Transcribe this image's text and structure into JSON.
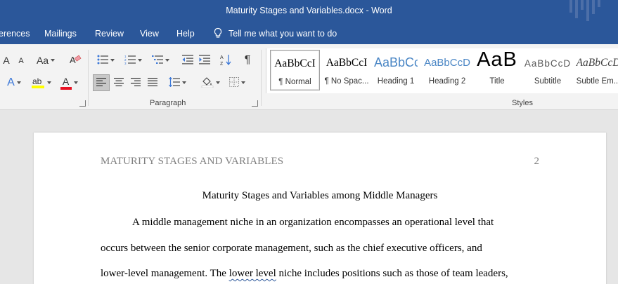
{
  "window": {
    "title": "Maturity Stages and Variables.docx  -  Word"
  },
  "tabs": [
    {
      "label": "erences"
    },
    {
      "label": "Mailings"
    },
    {
      "label": "Review"
    },
    {
      "label": "View"
    },
    {
      "label": "Help"
    }
  ],
  "tell_me": {
    "label": "Tell me what you want to do"
  },
  "ribbon": {
    "font_grow": "A",
    "font_shrink": "A",
    "change_case": "Aa",
    "text_effects": "A",
    "font_color": "A",
    "paragraph_label": "Paragraph",
    "styles_label": "Styles",
    "show_marks": "¶"
  },
  "styles": [
    {
      "preview": "AaBbCcI",
      "label": "¶ Normal"
    },
    {
      "preview": "AaBbCcI",
      "label": "¶ No Spac..."
    },
    {
      "preview": "AaBbCc",
      "label": "Heading 1"
    },
    {
      "preview": "AaBbCcD",
      "label": "Heading 2"
    },
    {
      "preview": "AaB",
      "label": "Title"
    },
    {
      "preview": "AaBbCcD",
      "label": "Subtitle"
    },
    {
      "preview": "AaBbCcD",
      "label": "Subtle Em..."
    }
  ],
  "colors": {
    "ribbon_blue": "#2b579a",
    "highlight": "#ffff00",
    "font_color": "#e81123"
  },
  "document": {
    "running_head": "MATURITY STAGES AND VARIABLES",
    "page_number": "2",
    "title": "Maturity Stages and Variables among Middle Managers",
    "line1": "A middle management niche in an organization encompasses an operational level that",
    "line2": "occurs between the senior corporate management, such as the chief executive officers, and",
    "line3_a": "lower-level management. The ",
    "line3_b": "lower level",
    "line3_c": " niche includes positions such as those of team leaders,"
  }
}
